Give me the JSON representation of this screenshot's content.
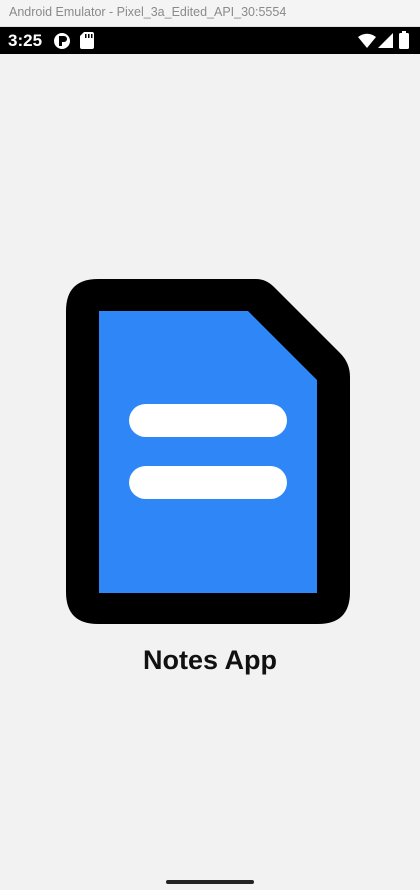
{
  "window": {
    "title": "Android Emulator - Pixel_3a_Edited_API_30:5554"
  },
  "status_bar": {
    "time": "3:25",
    "icons_left": [
      "app-notification-icon",
      "sd-card-icon"
    ],
    "icons_right": [
      "wifi-icon",
      "cell-signal-icon",
      "battery-icon"
    ]
  },
  "app": {
    "title": "Notes App",
    "logo_icon": "document-icon",
    "colors": {
      "logo_fill": "#2f86f6",
      "logo_outline": "#000000",
      "lines": "#ffffff",
      "background": "#f2f2f2"
    }
  }
}
